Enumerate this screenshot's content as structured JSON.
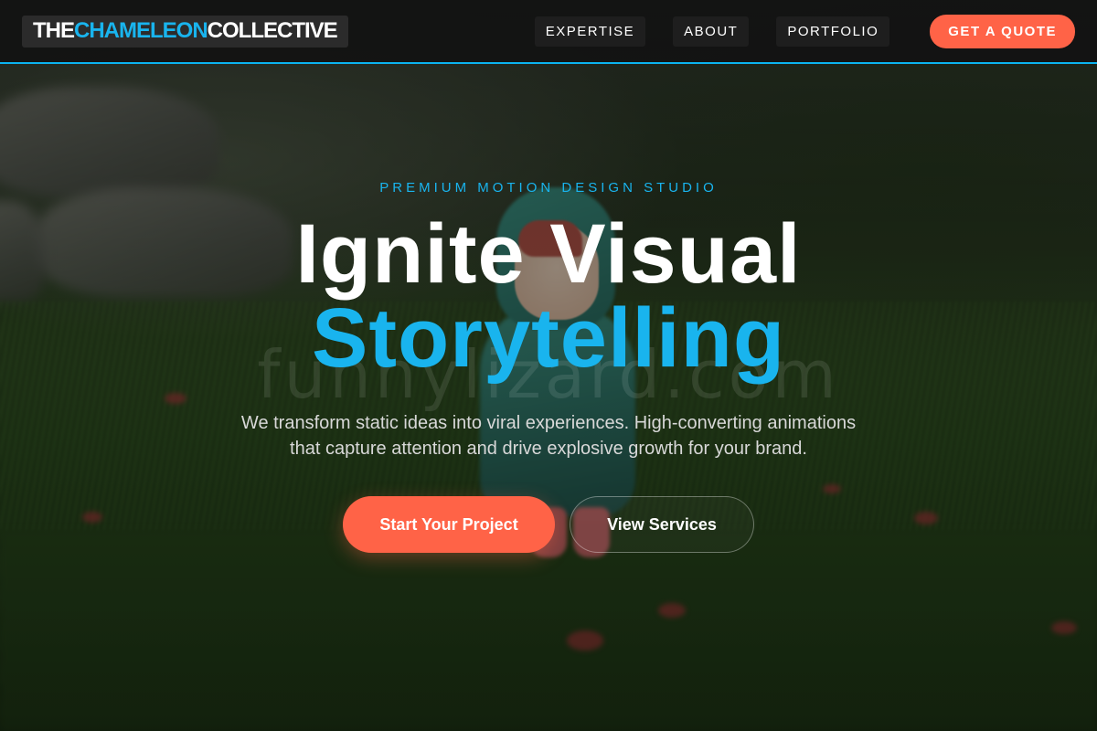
{
  "nav": {
    "logo": {
      "part1": "THE ",
      "accent": "CHAMELEON",
      "part2": " COLLECTIVE"
    },
    "links": [
      "EXPERTISE",
      "ABOUT",
      "PORTFOLIO"
    ],
    "cta": "GET A QUOTE"
  },
  "hero": {
    "eyebrow": "PREMIUM MOTION DESIGN STUDIO",
    "headline_line1": "Ignite Visual",
    "headline_line2": "Storytelling",
    "subtitle": "We transform static ideas into viral experiences. High-converting animations that capture attention and drive explosive growth for your brand.",
    "primary_button": "Start Your Project",
    "secondary_button": "View Services"
  },
  "watermark": "funnylizard.com",
  "colors": {
    "accent": "#19b4ee",
    "cta": "#ff6347",
    "nav_bg": "#121212"
  }
}
